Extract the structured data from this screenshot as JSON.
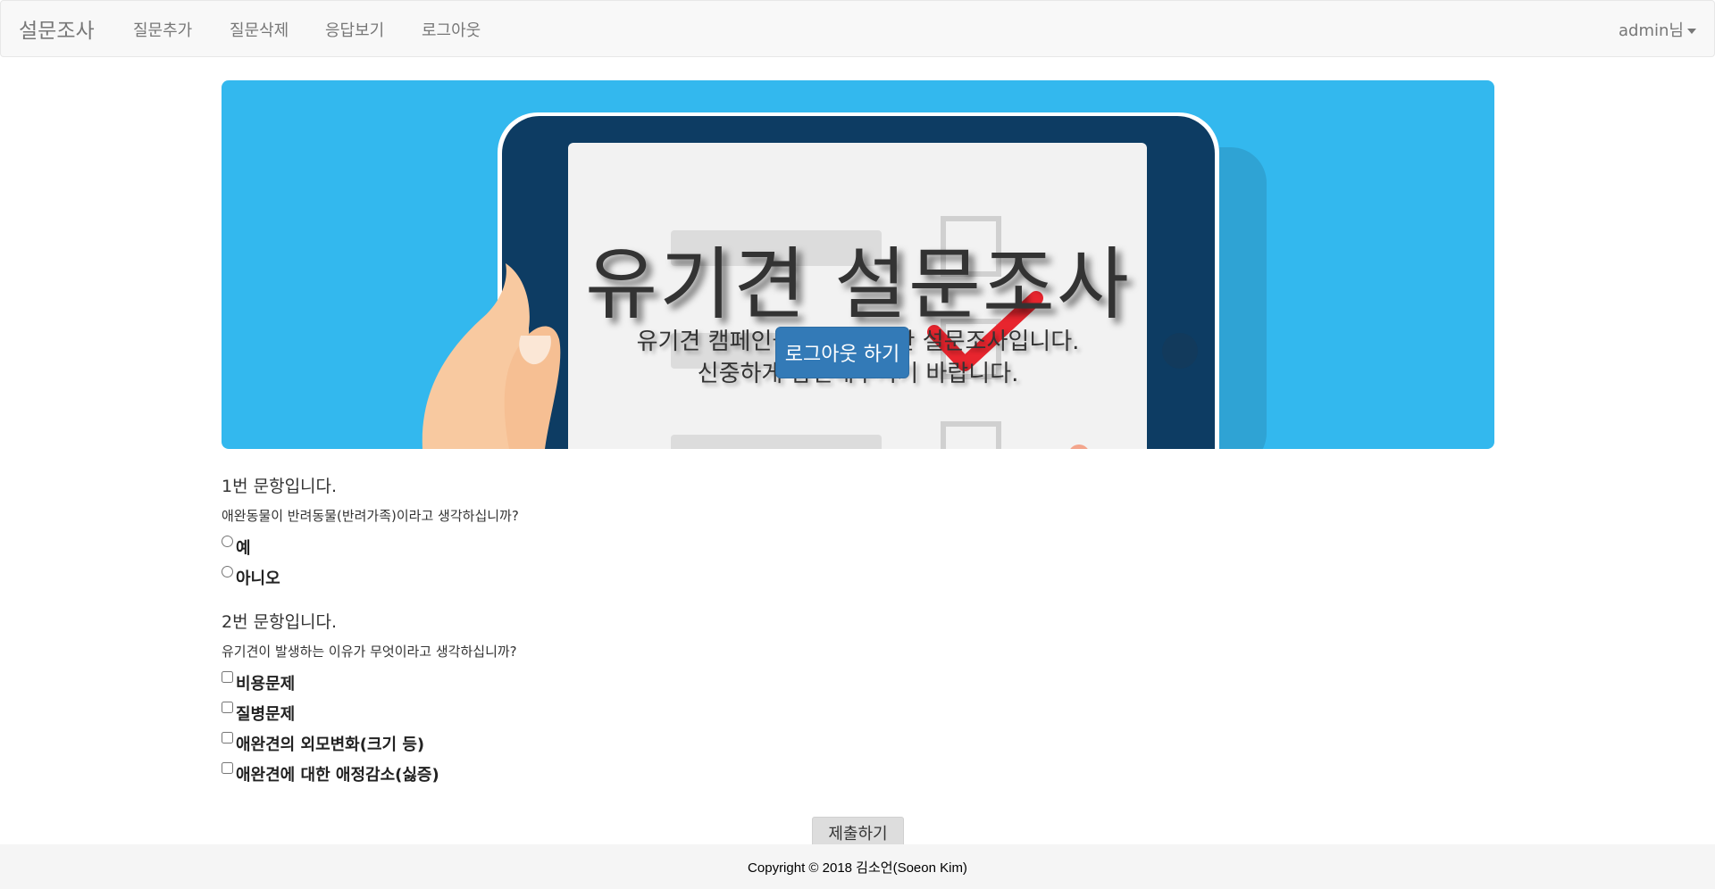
{
  "navbar": {
    "brand": "설문조사",
    "items": [
      {
        "label": "질문추가"
      },
      {
        "label": "질문삭제"
      },
      {
        "label": "응답보기"
      },
      {
        "label": "로그아웃"
      }
    ],
    "user_label": "admin님"
  },
  "jumbotron": {
    "title": "유기견 설문조사",
    "subtitle_line1": "유기견 캠페인을 위한 간단한 설문조사입니다.",
    "subtitle_line2": "신중하게 답변해주시기 바랍니다.",
    "button_label": "로그아웃 하기",
    "background_color": "#33b8ee"
  },
  "questions": [
    {
      "number_label": "1번 문항입니다.",
      "text": "애완동물이 반려동물(반려가족)이라고 생각하십니까?",
      "input_type": "radio",
      "options": [
        "예",
        "아니오"
      ]
    },
    {
      "number_label": "2번 문항입니다.",
      "text": "유기견이 발생하는 이유가 무엇이라고 생각하십니까?",
      "input_type": "checkbox",
      "options": [
        "비용문제",
        "질병문제",
        "애완견의 외모변화(크기 등)",
        "애완견에 대한 애정감소(싫증)"
      ]
    }
  ],
  "submit_label": "제출하기",
  "footer": {
    "text": "Copyright © 2018 김소언(Soeon Kim)"
  },
  "colors": {
    "primary_button": "#337ab7",
    "navbar_bg": "#f8f8f8"
  }
}
